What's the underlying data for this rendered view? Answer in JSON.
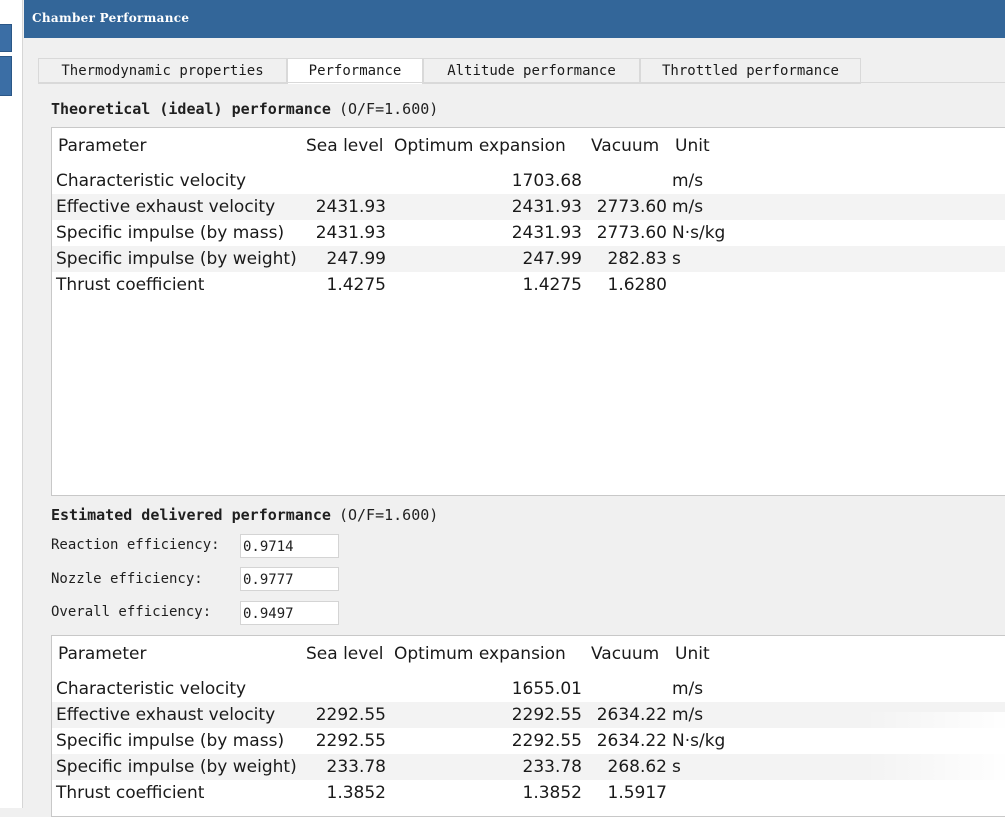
{
  "window": {
    "title": "Chamber Performance"
  },
  "tabs": [
    {
      "label": "Thermodynamic properties",
      "active": false
    },
    {
      "label": "Performance",
      "active": true
    },
    {
      "label": "Altitude performance",
      "active": false
    },
    {
      "label": "Throttled performance",
      "active": false
    }
  ],
  "theoretical": {
    "heading": "Theoretical (ideal) performance",
    "of_ratio": "(O/F=1.600)",
    "columns": [
      "Parameter",
      "Sea level",
      "Optimum expansion",
      "Vacuum",
      "Unit"
    ],
    "rows": [
      {
        "param": "Characteristic velocity",
        "sea": "",
        "opt": "1703.68",
        "vac": "",
        "unit": "m/s"
      },
      {
        "param": "Effective exhaust velocity",
        "sea": "2431.93",
        "opt": "2431.93",
        "vac": "2773.60",
        "unit": "m/s"
      },
      {
        "param": "Specific impulse (by mass)",
        "sea": "2431.93",
        "opt": "2431.93",
        "vac": "2773.60",
        "unit": "N·s/kg"
      },
      {
        "param": "Specific impulse (by weight)",
        "sea": "247.99",
        "opt": "247.99",
        "vac": "282.83",
        "unit": "s"
      },
      {
        "param": "Thrust coefficient",
        "sea": "1.4275",
        "opt": "1.4275",
        "vac": "1.6280",
        "unit": ""
      }
    ]
  },
  "delivered": {
    "heading": "Estimated delivered performance",
    "of_ratio": "(O/F=1.600)",
    "efficiencies": [
      {
        "label": "Reaction efficiency:",
        "value": "0.9714"
      },
      {
        "label": "Nozzle efficiency:",
        "value": "0.9777"
      },
      {
        "label": "Overall efficiency:",
        "value": "0.9497"
      }
    ],
    "columns": [
      "Parameter",
      "Sea level",
      "Optimum expansion",
      "Vacuum",
      "Unit"
    ],
    "rows": [
      {
        "param": "Characteristic velocity",
        "sea": "",
        "opt": "1655.01",
        "vac": "",
        "unit": "m/s"
      },
      {
        "param": "Effective exhaust velocity",
        "sea": "2292.55",
        "opt": "2292.55",
        "vac": "2634.22",
        "unit": "m/s"
      },
      {
        "param": "Specific impulse (by mass)",
        "sea": "2292.55",
        "opt": "2292.55",
        "vac": "2634.22",
        "unit": "N·s/kg"
      },
      {
        "param": "Specific impulse (by weight)",
        "sea": "233.78",
        "opt": "233.78",
        "vac": "268.62",
        "unit": "s"
      },
      {
        "param": "Thrust coefficient",
        "sea": "1.3852",
        "opt": "1.3852",
        "vac": "1.5917",
        "unit": ""
      }
    ]
  },
  "colors": {
    "titlebar": "#336699",
    "accent": "#3b6ea5"
  }
}
